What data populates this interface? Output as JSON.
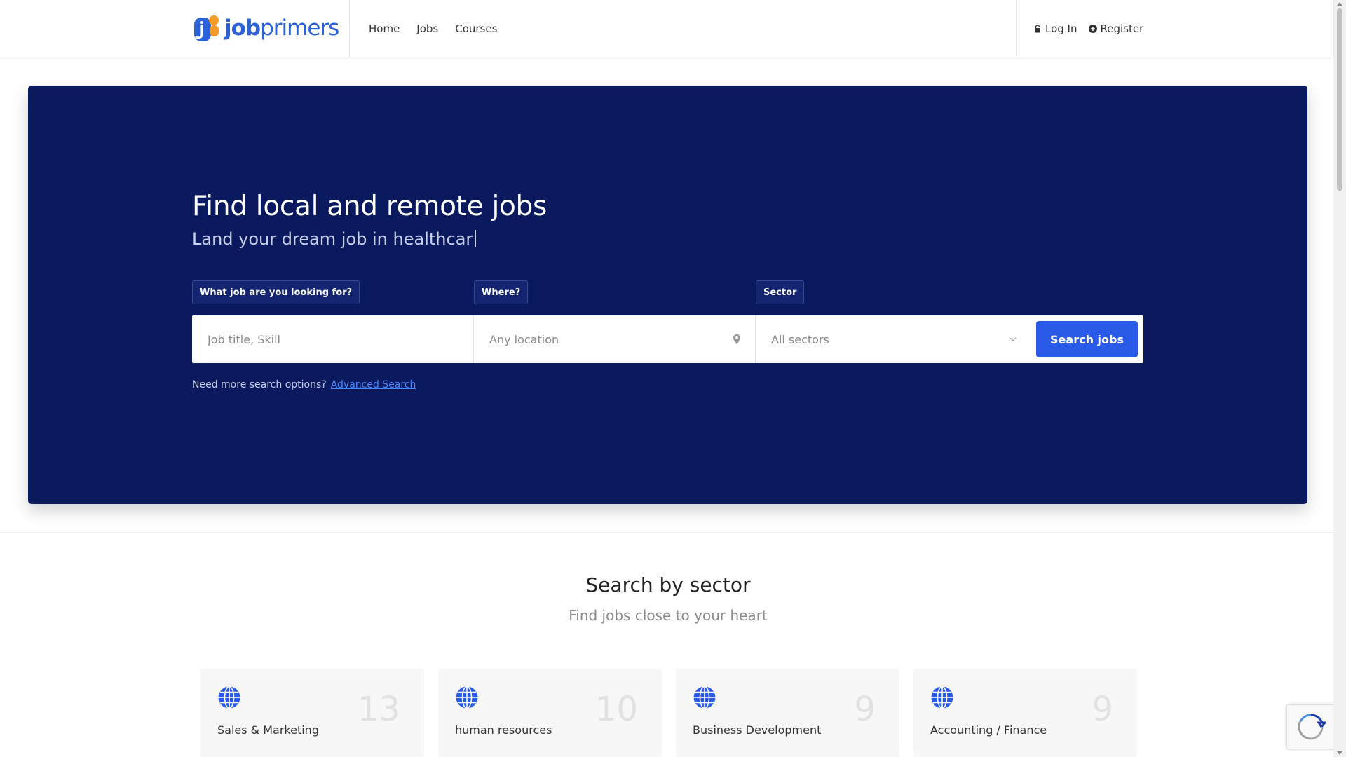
{
  "brand": {
    "name_bold": "job",
    "name_rest": "primers",
    "color": "#2a61d6",
    "accent_orange": "#f39a2a"
  },
  "nav": {
    "items": [
      "Home",
      "Jobs",
      "Courses"
    ]
  },
  "auth": {
    "login": "Log In",
    "register": "Register",
    "login_icon": "lock-icon",
    "register_icon": "plus-circle-icon"
  },
  "hero": {
    "title": "Find local and remote jobs",
    "subtitle": "Land your dream job in healthcar",
    "background": "#0b1a5f",
    "labels": {
      "what": "What job are you looking for?",
      "where": "Where?",
      "sector": "Sector"
    },
    "search": {
      "job_placeholder": "Job title, Skill",
      "location_placeholder": "Any location",
      "sector_value": "All sectors",
      "button": "Search jobs",
      "button_color": "#2a5ae8"
    },
    "advanced": {
      "prompt": "Need more search options?",
      "link": "Advanced Search"
    }
  },
  "sectors": {
    "title": "Search by sector",
    "subtitle": "Find jobs close to your heart",
    "items": [
      {
        "name": "Sales & Marketing",
        "count": "13",
        "icon": "globe-icon"
      },
      {
        "name": "human resources",
        "count": "10",
        "icon": "globe-icon"
      },
      {
        "name": "Business Development",
        "count": "9",
        "icon": "globe-icon"
      },
      {
        "name": "Accounting / Finance",
        "count": "9",
        "icon": "globe-icon"
      }
    ]
  }
}
